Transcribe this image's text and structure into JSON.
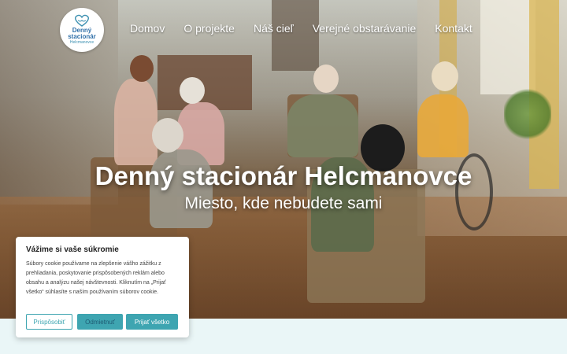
{
  "logo": {
    "line1": "Denný",
    "line2": "stacionár",
    "line3": "Helcmanovce"
  },
  "nav": {
    "items": [
      "Domov",
      "O projekte",
      "Náš cieľ",
      "Verejné obstarávanie",
      "Kontakt"
    ]
  },
  "hero": {
    "title": "Denný stacionár Helcmanovce",
    "subtitle": "Miesto, kde nebudete sami"
  },
  "cookie": {
    "title": "Vážime si vaše súkromie",
    "text": "Súbory cookie používame na zlepšenie vášho zážitku z prehliadania, poskytovanie prispôsobených reklám alebo obsahu a analýzu našej návštevnosti. Kliknutím na „Prijať všetko“ súhlasíte s naším používaním súborov cookie.",
    "customize_label": "Prispôsobiť",
    "reject_label": "Odmietnuť",
    "accept_label": "Prijať všetko"
  },
  "colors": {
    "accent": "#3ea5b1",
    "logo_text": "#2f6fa8",
    "band": "#eaf6f7"
  }
}
